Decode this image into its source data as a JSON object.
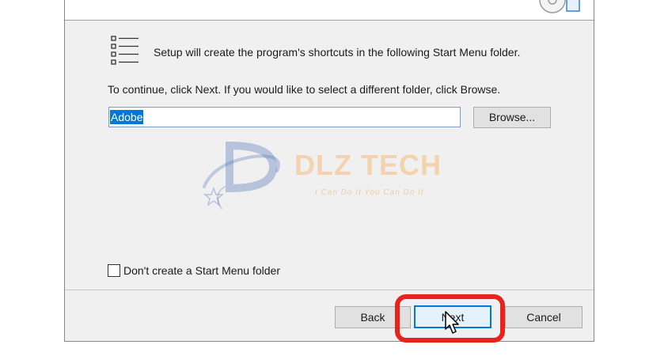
{
  "wizard": {
    "intro_text": "Setup will create the program's shortcuts in the following Start Menu folder.",
    "instruction_text": "To continue, click Next. If you would like to select a different folder, click Browse.",
    "folder_value": "Adobe",
    "browse_label": "Browse...",
    "no_folder_label": "Don't create a Start Menu folder",
    "no_folder_checked": false,
    "back_label": "Back",
    "next_label": "Next",
    "cancel_label": "Cancel"
  },
  "watermark": {
    "title": "DLZ TECH",
    "tagline": "I Can Do It You Can Do It"
  },
  "icons": {
    "header": "setup-disc-box-icon",
    "list": "list-icon",
    "cursor": "mouse-pointer-icon"
  },
  "colors": {
    "highlight": "#e8231c",
    "selection": "#0078d7",
    "default_button_border": "#0078d7",
    "watermark_title": "#f5bc78",
    "watermark_logo": "#4a6fb5"
  }
}
